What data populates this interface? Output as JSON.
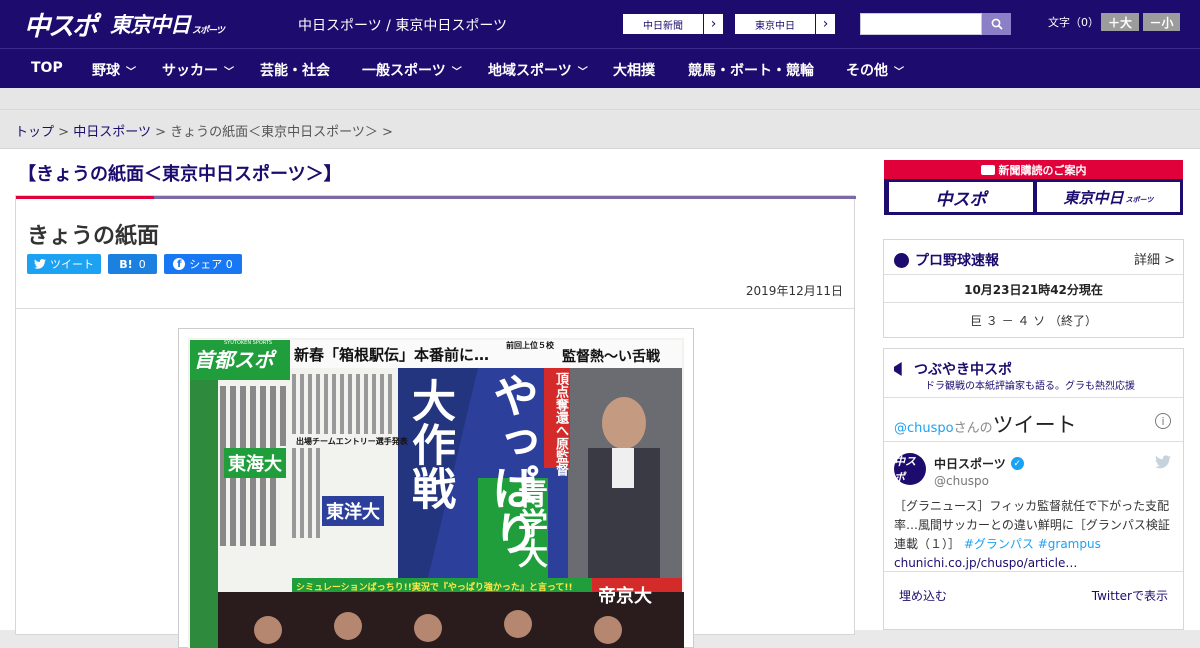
{
  "header": {
    "logo_chuspo": "中スポ",
    "logo_tokyo": "東京中日",
    "logo_tokyo_sub": "スポーツ",
    "site_title": "中日スポーツ / 東京中日スポーツ",
    "ext_links": [
      "中日新聞",
      "東京中日"
    ],
    "search_placeholder": "",
    "font_label": "文字（0）",
    "font_plus": "＋大",
    "font_minus": "－小"
  },
  "nav": {
    "items": [
      {
        "label": "TOP",
        "dropdown": false
      },
      {
        "label": "野球",
        "dropdown": true
      },
      {
        "label": "サッカー",
        "dropdown": true
      },
      {
        "label": "芸能・社会",
        "dropdown": false
      },
      {
        "label": "一般スポーツ",
        "dropdown": true
      },
      {
        "label": "地域スポーツ",
        "dropdown": true
      },
      {
        "label": "大相撲",
        "dropdown": false
      },
      {
        "label": "競馬・ボート・競輪",
        "dropdown": false
      },
      {
        "label": "その他",
        "dropdown": true
      }
    ]
  },
  "breadcrumb": {
    "items": [
      "トップ",
      "中日スポーツ",
      "きょうの紙面＜東京中日スポーツ＞"
    ],
    "separator": ">"
  },
  "main": {
    "section_title": "【きょうの紙面＜東京中日スポーツ＞】",
    "article_title": "きょうの紙面",
    "share_tweet": "ツイート",
    "share_hatena_label": "B!",
    "share_hatena_count": "0",
    "share_fb": "シェア 0",
    "date": "2019年12月11日"
  },
  "paper": {
    "brand": "首都スポ",
    "brand_sub": "SYUTOKEN SPORTS",
    "headline_top": "新春「箱根駅伝」本番前に…",
    "headline_small": "前回上位５校",
    "headline_top_right": "監督熱～い舌戦",
    "main_a": "大作戦",
    "main_b": "やっぱり",
    "main_c": "青学大",
    "tagline": "頂点奪還へ原監督",
    "side_1": "東海大",
    "side_2": "東洋大",
    "side_3": "帝京大",
    "entry": "出場チームエントリー選手発表",
    "bottom_strip": "シミュレーションばっちり!!実況で『やっぱり強かった』と言って!!"
  },
  "sidebar": {
    "promo_title": "新聞購読のご案内",
    "promo_btn_1": "中スポ",
    "promo_btn_2": "東京中日",
    "promo_btn_2_sub": "スポーツ",
    "baseball": {
      "title": "プロ野球速報",
      "detail": "詳細 >",
      "time": "10月23日21時42分現在",
      "score": "巨 ３ － ４ ソ （終了）"
    },
    "tweets": {
      "title": "つぶやき中スポ",
      "subtitle": "ドラ観戦の本紙評論家も語る。グラも熱烈応援",
      "header_handle": "@chuspo",
      "header_san": "さんの",
      "header_tweet": "ツイート",
      "name": "中日スポーツ",
      "handle": "@chuspo",
      "avatar_text": "中スポ",
      "text": "［グラニュース］フィッカ監督就任で下がった支配率…風間サッカーとの違い鮮明に［グランパス検証連載（１）］",
      "hashtags": "#グランパス #grampus",
      "url": "chunichi.co.jp/chuspo/article…",
      "embed": "埋め込む",
      "view_on_twitter": "Twitterで表示"
    }
  },
  "colors": {
    "brand_navy": "#1d0c6e",
    "accent_red": "#e0003a",
    "twitter_blue": "#1da1f2"
  }
}
